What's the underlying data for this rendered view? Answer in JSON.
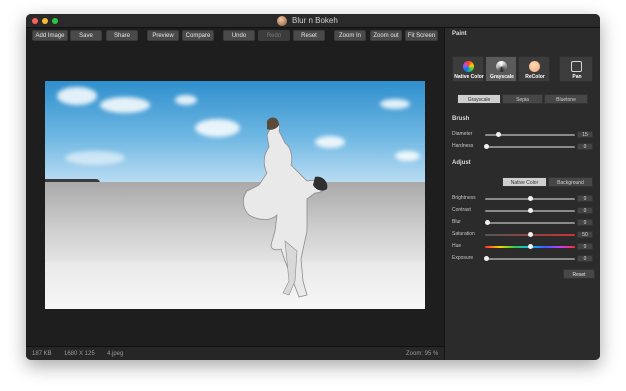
{
  "window": {
    "title": "Blur n Bokeh"
  },
  "toolbar": [
    {
      "label": "Add Image",
      "enabled": true
    },
    {
      "label": "Save",
      "enabled": true
    },
    {
      "label": "Share",
      "enabled": true
    },
    {
      "label": "Preview",
      "enabled": true
    },
    {
      "label": "Compare",
      "enabled": true
    },
    {
      "label": "Undo",
      "enabled": true
    },
    {
      "label": "Redo",
      "enabled": false
    },
    {
      "label": "Reset",
      "enabled": true
    },
    {
      "label": "Zoom In",
      "enabled": true
    },
    {
      "label": "Zoom out",
      "enabled": true
    },
    {
      "label": "Fit Screen",
      "enabled": true
    }
  ],
  "status": {
    "size": "187 KB",
    "dimensions": "1680 X 125",
    "filename": "4.jpeg",
    "zoom": "Zoom: 95 %"
  },
  "panel": {
    "paint_label": "Paint",
    "modes": [
      {
        "label": "Native Color",
        "icon": "color-wheel-icon",
        "active": false
      },
      {
        "label": "Grayscale",
        "icon": "grayscale-wheel-icon",
        "active": true
      },
      {
        "label": "ReColor",
        "icon": "recolor-icon",
        "active": false
      },
      {
        "label": "Pan",
        "icon": "hand-icon",
        "active": false
      }
    ],
    "filters": [
      {
        "label": "Grayscale",
        "active": true
      },
      {
        "label": "Sepia",
        "active": false
      },
      {
        "label": "Bluetone",
        "active": false
      }
    ],
    "brush_label": "Brush",
    "brush": [
      {
        "label": "Diameter",
        "value": "15"
      },
      {
        "label": "Hardness",
        "value": "0"
      }
    ],
    "adjust_label": "Adjust",
    "adjust_tabs": [
      {
        "label": "Native Color",
        "active": true
      },
      {
        "label": "Background",
        "active": false
      }
    ],
    "adjust": [
      {
        "label": "Brightness",
        "value": "0"
      },
      {
        "label": "Contrast",
        "value": "0"
      },
      {
        "label": "Blur",
        "value": "0"
      },
      {
        "label": "Saturation",
        "value": "50"
      },
      {
        "label": "Hue",
        "value": "0"
      },
      {
        "label": "Exposure",
        "value": "0"
      }
    ],
    "reset_label": "Reset"
  }
}
